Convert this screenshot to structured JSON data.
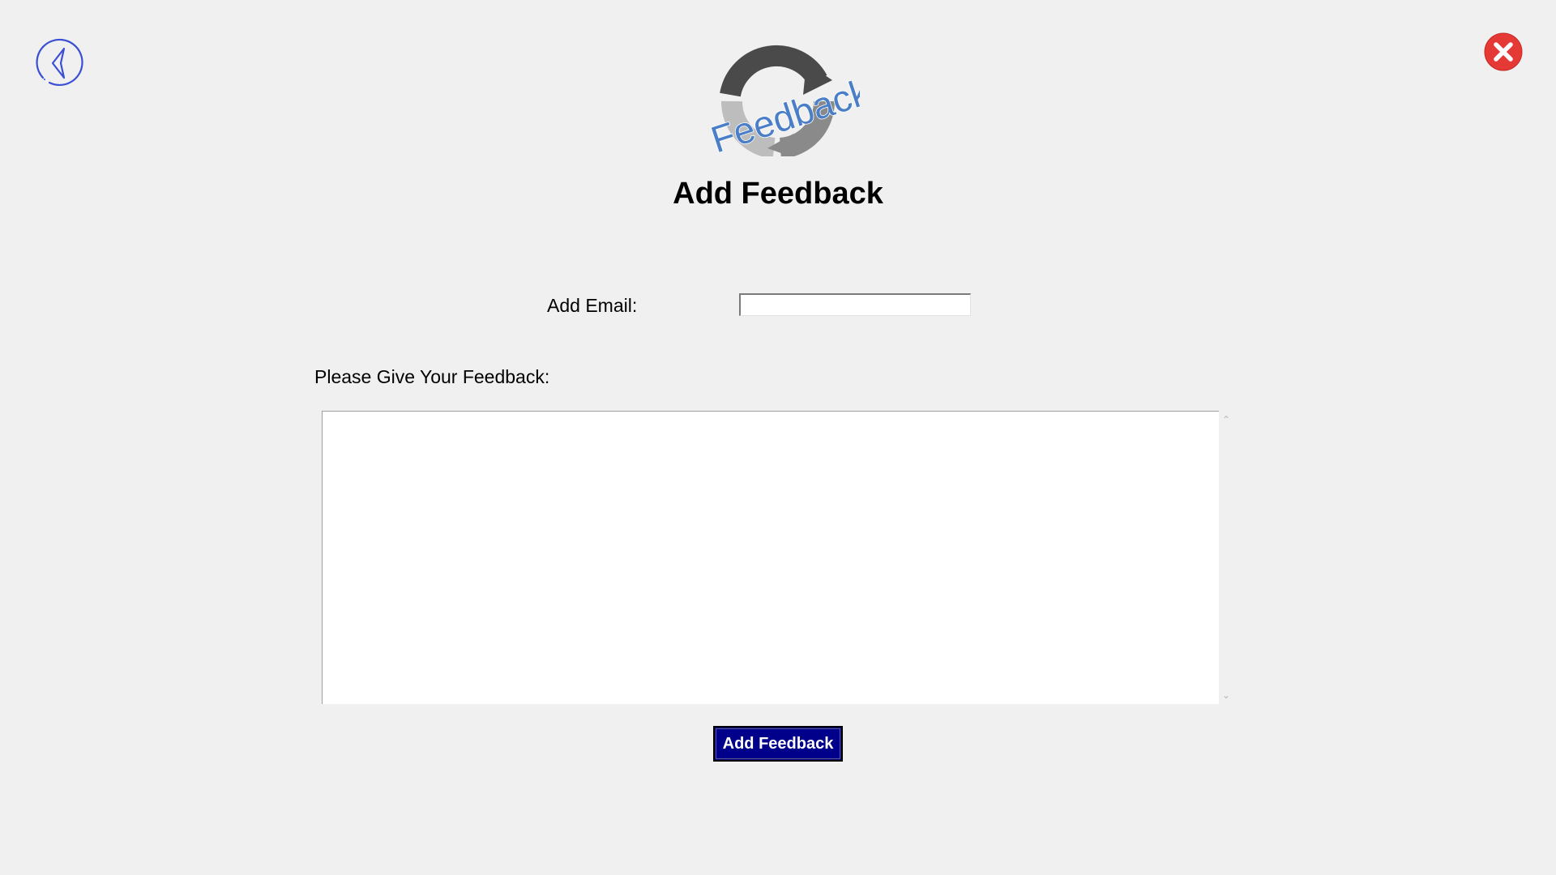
{
  "header": {
    "logo_text": "Feedback",
    "title": "Add Feedback"
  },
  "icons": {
    "back": "back-arrow-icon",
    "close": "close-icon"
  },
  "form": {
    "email_label": "Add Email:",
    "email_value": "",
    "feedback_label": "Please Give Your Feedback:",
    "feedback_value": "",
    "submit_label": "Add Feedback"
  },
  "colors": {
    "background": "#f0f0f0",
    "button_bg": "#00008b",
    "close_red": "#e53935",
    "back_blue": "#3b4fd4",
    "logo_blue": "#4a7ec7"
  }
}
